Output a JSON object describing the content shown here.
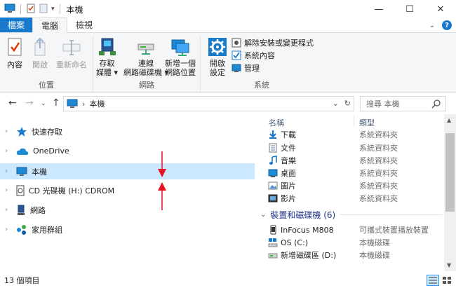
{
  "window": {
    "title": "本機",
    "controls": {
      "minimize": "—",
      "maximize": "☐",
      "close": "✕"
    }
  },
  "tabs": [
    {
      "label": "檔案",
      "active": false
    },
    {
      "label": "電腦",
      "active": true
    },
    {
      "label": "檢視",
      "active": false
    }
  ],
  "ribbon": {
    "groups": {
      "location": {
        "label": "位置",
        "buttons": [
          {
            "label": "內容",
            "enabled": true,
            "icon": "properties-check-icon"
          },
          {
            "label": "開啟",
            "enabled": false,
            "icon": "open-icon"
          },
          {
            "label": "重新命名",
            "enabled": false,
            "icon": "rename-icon"
          }
        ]
      },
      "network": {
        "label": "網路",
        "buttons": [
          {
            "label1": "存取",
            "label2": "媒體",
            "icon": "media-access-icon"
          },
          {
            "label1": "連線",
            "label2": "網路磁碟機",
            "icon": "map-drive-icon"
          },
          {
            "label1": "新增一個",
            "label2": "網路位置",
            "icon": "network-location-icon"
          }
        ]
      },
      "system": {
        "label": "系統",
        "big": {
          "label1": "開啟",
          "label2": "設定",
          "icon": "gear-icon"
        },
        "small": [
          {
            "label": "解除安裝或變更程式",
            "icon": "uninstall-icon"
          },
          {
            "label": "系統內容",
            "icon": "system-properties-icon"
          },
          {
            "label": "管理",
            "icon": "manage-icon"
          }
        ]
      }
    }
  },
  "address": {
    "path": "本機",
    "search_placeholder": "搜尋 本機"
  },
  "nav": {
    "items": [
      {
        "label": "快速存取",
        "icon": "star-icon",
        "selected": false
      },
      {
        "label": "OneDrive",
        "icon": "cloud-icon",
        "selected": false
      },
      {
        "label": "本機",
        "icon": "computer-icon",
        "selected": true
      },
      {
        "label": "CD 光碟機 (H:) CDROM",
        "icon": "cd-drive-icon",
        "selected": false
      },
      {
        "label": "網路",
        "icon": "network-icon",
        "selected": false
      },
      {
        "label": "家用群組",
        "icon": "homegroup-icon",
        "selected": false
      }
    ]
  },
  "files": {
    "columns": {
      "name": "名稱",
      "type": "類型"
    },
    "folders": [
      {
        "name": "下載",
        "type": "系統資料夾",
        "icon": "download-icon"
      },
      {
        "name": "文件",
        "type": "系統資料夾",
        "icon": "documents-icon"
      },
      {
        "name": "音樂",
        "type": "系統資料夾",
        "icon": "music-icon"
      },
      {
        "name": "桌面",
        "type": "系統資料夾",
        "icon": "desktop-icon"
      },
      {
        "name": "圖片",
        "type": "系統資料夾",
        "icon": "pictures-icon"
      },
      {
        "name": "影片",
        "type": "系統資料夾",
        "icon": "videos-icon"
      }
    ],
    "devices_header": "裝置和磁碟機 (6)",
    "devices": [
      {
        "name": "InFocus M808",
        "type": "可攜式裝置播放裝置",
        "icon": "phone-icon"
      },
      {
        "name": "OS (C:)",
        "type": "本機磁碟",
        "icon": "os-drive-icon"
      },
      {
        "name": "新增磁碟區 (D:)",
        "type": "本機磁碟",
        "icon": "hard-drive-icon"
      }
    ]
  },
  "status": {
    "count": "13 個項目"
  },
  "colors": {
    "accent": "#1979ca",
    "selected": "#cce8ff",
    "arrow": "#e81123"
  }
}
